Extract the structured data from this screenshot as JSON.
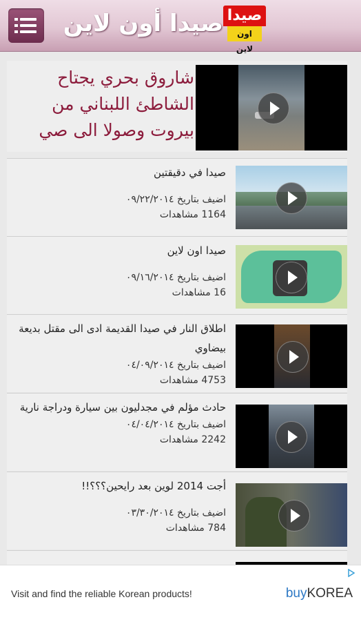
{
  "header": {
    "title": "صيدا أون لاين",
    "logo_top": "صيدا",
    "logo_bottom": "اون لاين"
  },
  "featured": {
    "title": "شاروق بحري يجتاح الشاطئ اللبناني من بيروت وصولا الى صي"
  },
  "videos": [
    {
      "title": "صيدا في دقيقتين",
      "date": "اضيف بتاريخ ٠٩/٢٢/٢٠١٤",
      "views": "1164 مشاهدات"
    },
    {
      "title": "صيدا اون لاين",
      "date": "اضيف بتاريخ ٠٩/١٦/٢٠١٤",
      "views": "16 مشاهدات"
    },
    {
      "title": "اطلاق النار في صيدا القديمة ادى الى مقتل بديعة بيضاوي",
      "date": "اضيف بتاريخ ٠٤/٠٩/٢٠١٤",
      "views": "4753 مشاهدات"
    },
    {
      "title": "حادث مؤلم في مجدليون بين سيارة ودراجة نارية",
      "date": "اضيف بتاريخ ٠٤/٠٤/٢٠١٤",
      "views": "2242 مشاهدات"
    },
    {
      "title": "أجت 2014 لوين بعد رايحين؟؟؟!!",
      "date": "اضيف بتاريخ ٠٣/٣٠/٢٠١٤",
      "views": "784 مشاهدات"
    }
  ],
  "ad": {
    "text": "Visit and find the reliable Korean products!",
    "brand_buy": "buy",
    "brand_korea": "KOREA"
  }
}
